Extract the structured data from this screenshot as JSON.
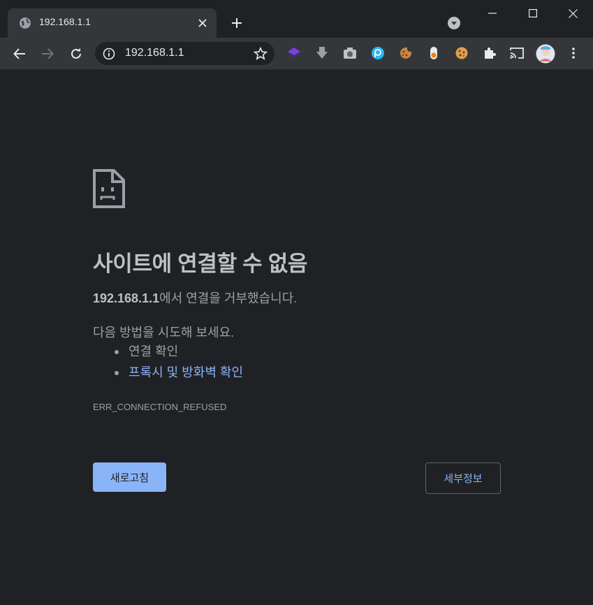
{
  "tab": {
    "title": "192.168.1.1",
    "favicon": "globe-icon"
  },
  "omnibox": {
    "url": "192.168.1.1"
  },
  "colors": {
    "background": "#202124",
    "toolbar": "#35363a",
    "accent": "#8ab4f8",
    "text": "#9aa0a6",
    "title": "#bdc1c6"
  },
  "error": {
    "title": "사이트에 연결할 수 없음",
    "host": "192.168.1.1",
    "message_suffix": "에서 연결을 거부했습니다.",
    "try_label": "다음 방법을 시도해 보세요.",
    "suggestions": [
      "연결 확인",
      "프록시 및 방화벽 확인"
    ],
    "code": "ERR_CONNECTION_REFUSED"
  },
  "buttons": {
    "reload": "새로고침",
    "details": "세부정보"
  }
}
